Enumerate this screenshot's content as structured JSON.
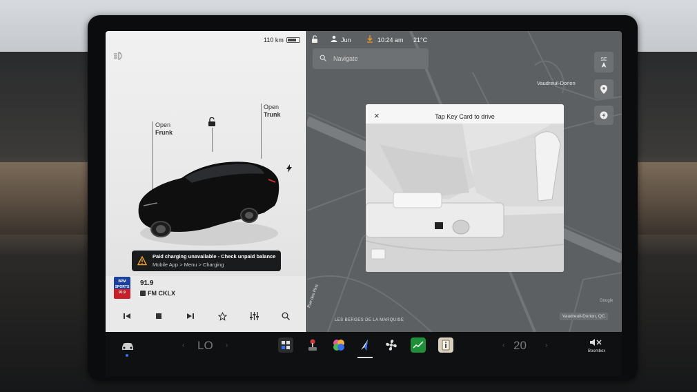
{
  "car_panel": {
    "range": "110 km",
    "frunk_open": "Open",
    "frunk_label": "Frunk",
    "trunk_open": "Open",
    "trunk_label": "Trunk"
  },
  "alert": {
    "title": "Paid charging unavailable - Check unpaid balance",
    "subtitle": "Mobile App > Menu > Charging"
  },
  "media": {
    "logo_text_1": "BPM",
    "logo_text_2": "SPORTS",
    "logo_text_3": "91.9",
    "frequency": "91.9",
    "station": "FM CKLX",
    "controls": [
      "previous-icon",
      "stop-icon",
      "next-icon",
      "favorite-star-icon",
      "equalizer-icon",
      "search-icon"
    ]
  },
  "status_bar": {
    "user": "Jun",
    "time": "10:24 am",
    "temperature": "21°C"
  },
  "map": {
    "navigate_placeholder": "Navigate",
    "place_top_right": "Vaudreuil-Dorion",
    "compass": "SE",
    "street_label": "Rue des Pins",
    "area_label": "LES BERGES DE LA MARQUISE",
    "location_badge": "Vaudreuil-Dorion, QC",
    "attribution": "Google"
  },
  "modal": {
    "title": "Tap Key Card to drive",
    "close": "×"
  },
  "dock": {
    "driver_temp": "LO",
    "passenger_temp": "20",
    "apps": [
      "car-icon",
      "controls-grid-icon",
      "joystick-icon",
      "arcade-icon",
      "navigation-icon",
      "fan-icon",
      "stocks-icon",
      "manual-icon"
    ],
    "audio_label": "Boombox"
  },
  "colors": {
    "accent_blue": "#3b6df0",
    "alert_bg": "#1a1b1c",
    "map_bg": "#5d6062"
  }
}
